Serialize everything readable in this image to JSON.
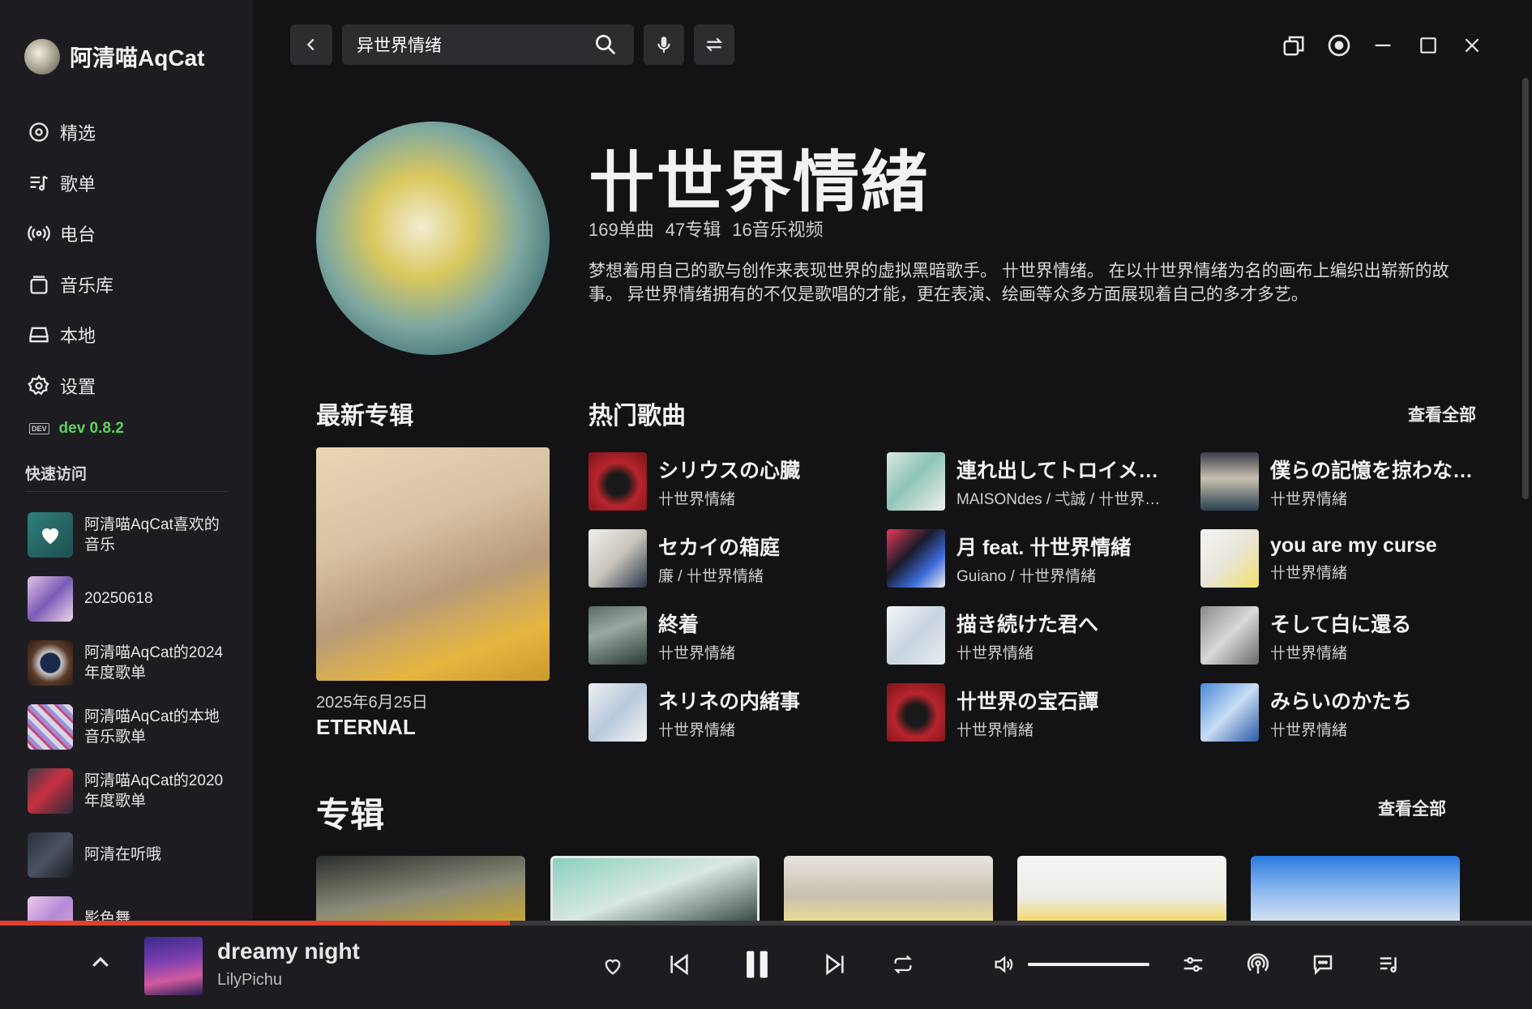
{
  "app": {
    "name": "阿清喵AqCat",
    "version": "dev 0.8.2",
    "dev_tag": "DEV"
  },
  "nav": [
    {
      "label": "精选",
      "icon": "compass-icon"
    },
    {
      "label": "歌单",
      "icon": "playlist-icon"
    },
    {
      "label": "电台",
      "icon": "radio-icon"
    },
    {
      "label": "音乐库",
      "icon": "library-icon"
    },
    {
      "label": "本地",
      "icon": "drive-icon"
    },
    {
      "label": "设置",
      "icon": "gear-icon"
    }
  ],
  "quick_access": {
    "title": "快速访问",
    "items": [
      {
        "label": "阿清喵AqCat喜欢的音乐"
      },
      {
        "label": "20250618"
      },
      {
        "label": "阿清喵AqCat的2024年度歌单"
      },
      {
        "label": "阿清喵AqCat的本地音乐歌单"
      },
      {
        "label": "阿清喵AqCat的2020年度歌单"
      },
      {
        "label": "阿清在听哦"
      },
      {
        "label": "影色舞"
      }
    ]
  },
  "search": {
    "value": "异世界情绪"
  },
  "artist": {
    "name": "卄世界情緒",
    "stats": [
      "169单曲",
      "47专辑",
      "16音乐视频"
    ],
    "bio": "梦想着用自己的歌与创作来表现世界的虚拟黑暗歌手。 卄世界情绪。 在以卄世界情绪为名的画布上编织出崭新的故事。 异世界情绪拥有的不仅是歌唱的才能，更在表演、绘画等众多方面展现着自己的多才多艺。"
  },
  "latest_album": {
    "section_title": "最新专辑",
    "date": "2025年6月25日",
    "title": "ETERNAL"
  },
  "hot_songs": {
    "section_title": "热门歌曲",
    "see_all": "查看全部",
    "songs": [
      {
        "title": "シリウスの心臓",
        "artist": "卄世界情緒"
      },
      {
        "title": "連れ出してトロイメ…",
        "artist": "MAISONdes / 弌誠 / 卄世界…"
      },
      {
        "title": "僕らの記憶を掠わな…",
        "artist": "卄世界情緒"
      },
      {
        "title": "セカイの箱庭",
        "artist": "廉 / 卄世界情緒"
      },
      {
        "title": "月 feat. 卄世界情緒",
        "artist": "Guiano / 卄世界情緒"
      },
      {
        "title": "you are my curse",
        "artist": "卄世界情緒"
      },
      {
        "title": "終着",
        "artist": "卄世界情緒"
      },
      {
        "title": "描き続けた君へ",
        "artist": "卄世界情緒"
      },
      {
        "title": "そして白に還る",
        "artist": "卄世界情緒"
      },
      {
        "title": "ネリネの内緒事",
        "artist": "卄世界情緒"
      },
      {
        "title": "卄世界の宝石譚",
        "artist": "卄世界情緒"
      },
      {
        "title": "みらいのかたち",
        "artist": "卄世界情緒"
      }
    ]
  },
  "albums": {
    "section_title": "专辑",
    "see_all": "查看全部",
    "count_visible": 5
  },
  "player": {
    "title": "dreamy night",
    "artist": "LilyPichu",
    "progress": 0.333,
    "volume": 1.0
  },
  "colors": {
    "accent": "#e0422d",
    "dev_green": "#5bd35b",
    "background": "#131315",
    "sidebar": "#1d1d21"
  }
}
